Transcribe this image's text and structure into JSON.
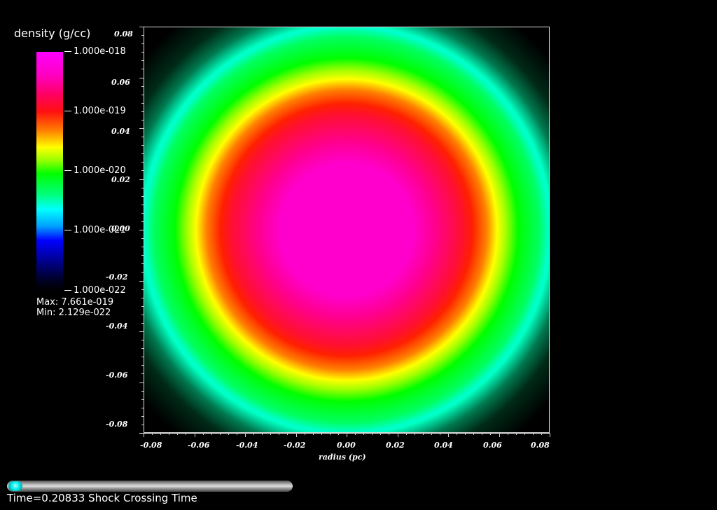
{
  "legend": {
    "title": "density (g/cc)",
    "labels": [
      "1.000e-018",
      "1.000e-019",
      "1.000e-020",
      "1.000e-021",
      "1.000e-022"
    ],
    "max": "Max:  7.661e-019",
    "min": "Min:  2.129e-022"
  },
  "axes": {
    "x_ticks": [
      "-0.08",
      "-0.06",
      "-0.04",
      "-0.02",
      "0.00",
      "0.02",
      "0.04",
      "0.06",
      "0.08"
    ],
    "y_ticks": [
      "0.08",
      "0.06",
      "0.04",
      "0.02",
      "0.00",
      "-0.02",
      "-0.04",
      "-0.06",
      "-0.08"
    ],
    "x_label": "radius (pc)"
  },
  "time": {
    "label": "Time=0.20833 Shock Crossing Time",
    "slider_fraction": 0.0
  }
}
